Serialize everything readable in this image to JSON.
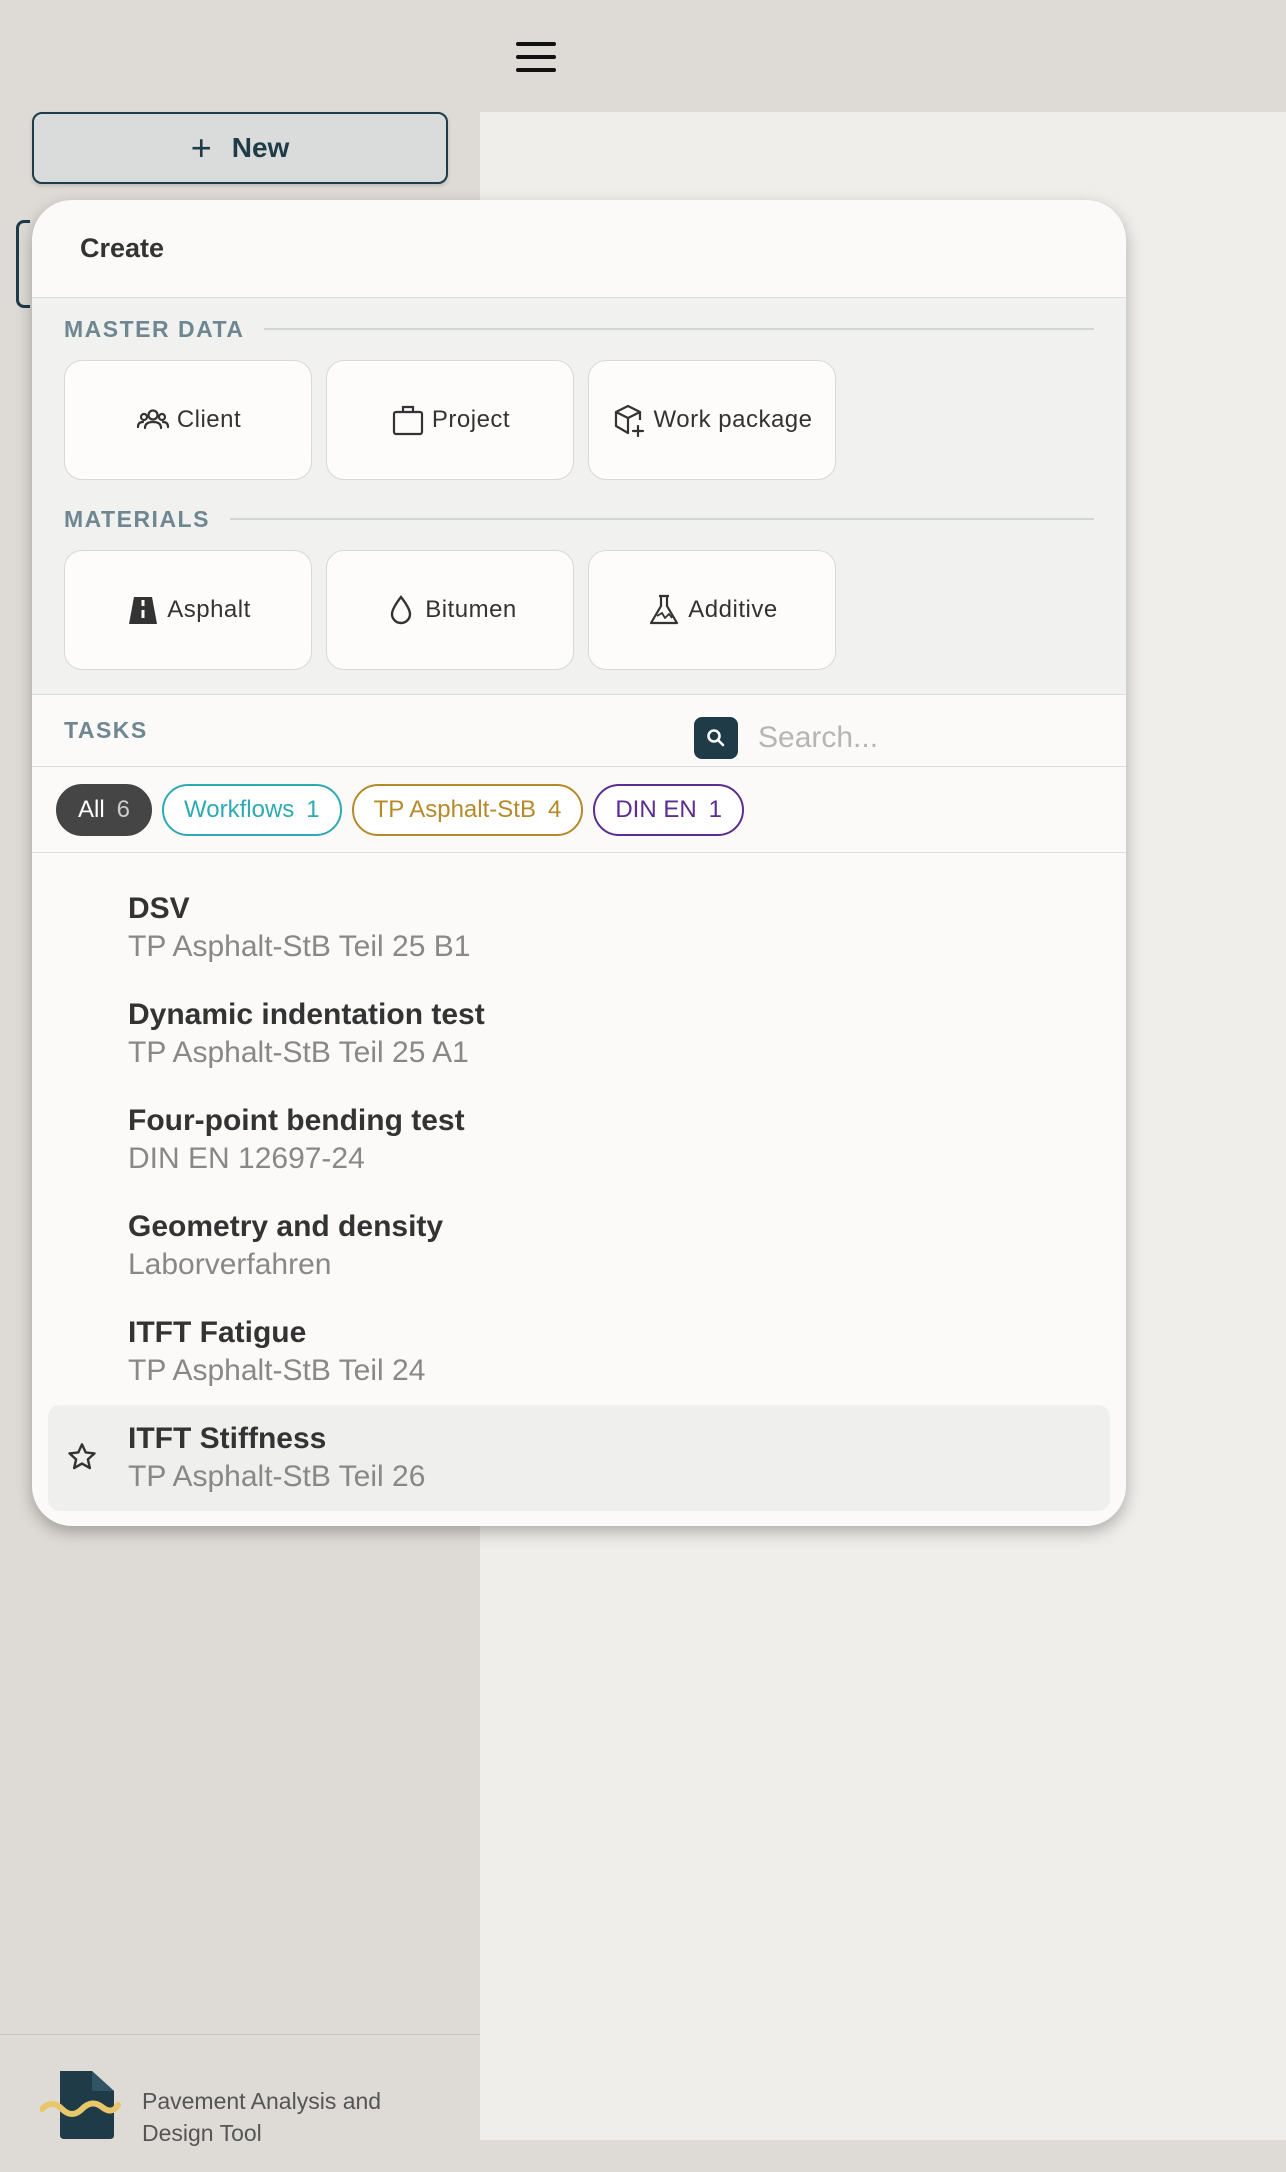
{
  "header": {
    "menu_icon": "hamburger-menu-icon"
  },
  "sidebar": {
    "new_button": {
      "label": "New",
      "icon": "plus-icon"
    },
    "footer": {
      "app_name": "Pavement Analysis and Design Tool",
      "logo_icon": "app-logo-icon"
    }
  },
  "create_menu": {
    "title": "Create",
    "master_data": {
      "title": "MASTER DATA",
      "items": [
        {
          "label": "Client",
          "icon": "users-icon"
        },
        {
          "label": "Project",
          "icon": "briefcase-icon"
        },
        {
          "label": "Work package",
          "icon": "box-plus-icon"
        }
      ]
    },
    "materials": {
      "title": "MATERIALS",
      "items": [
        {
          "label": "Asphalt",
          "icon": "road-icon"
        },
        {
          "label": "Bitumen",
          "icon": "droplet-icon"
        },
        {
          "label": "Additive",
          "icon": "flask-icon"
        }
      ]
    },
    "tasks": {
      "title": "TASKS",
      "search_placeholder": "Search...",
      "filters": [
        {
          "label": "All",
          "count": "6",
          "color": "#454545"
        },
        {
          "label": "Workflows",
          "count": "1",
          "color": "#2fa9b3"
        },
        {
          "label": "TP Asphalt-StB",
          "count": "4",
          "color": "#b48a2a"
        },
        {
          "label": "DIN EN",
          "count": "1",
          "color": "#5b2d90"
        }
      ],
      "items": [
        {
          "name": "DSV",
          "standard": "TP Asphalt-StB Teil 25 B1"
        },
        {
          "name": "Dynamic indentation test",
          "standard": "TP Asphalt-StB Teil 25 A1"
        },
        {
          "name": "Four-point bending test",
          "standard": "DIN EN 12697-24"
        },
        {
          "name": "Geometry and density",
          "standard": "Laborverfahren"
        },
        {
          "name": "ITFT Fatigue",
          "standard": "TP Asphalt-StB Teil 24"
        },
        {
          "name": "ITFT Stiffness",
          "standard": "TP Asphalt-StB Teil 26",
          "hovered": true,
          "icon": "star-icon"
        }
      ]
    }
  },
  "colors": {
    "accent": "#1e3b47",
    "background": "#dedbd6",
    "logo_wave": "#e8c66a"
  }
}
